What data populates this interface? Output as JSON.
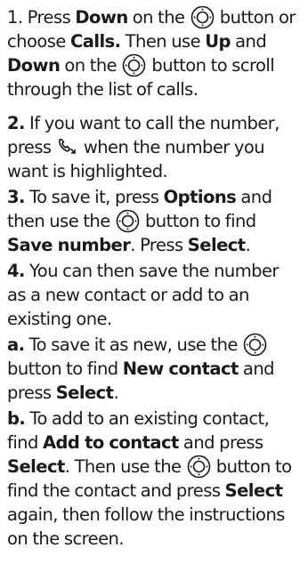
{
  "steps": [
    {
      "id": "1",
      "parts": [
        {
          "t": "1. Press "
        },
        {
          "b": "Down"
        },
        {
          "t": " on the "
        },
        {
          "icon": "nav-button"
        },
        {
          "t": " button or choose "
        },
        {
          "b": "Calls."
        },
        {
          "t": " Then use "
        },
        {
          "b": "Up"
        },
        {
          "t": " and "
        },
        {
          "b": "Down"
        },
        {
          "t": " on the "
        },
        {
          "icon": "nav-button"
        },
        {
          "t": " button to scroll through the list of calls."
        }
      ]
    },
    {
      "id": "2",
      "parts": [
        {
          "b": "2."
        },
        {
          "t": " If you want to call the number, press "
        },
        {
          "icon": "call-key"
        },
        {
          "t": " when the number you want is highlighted."
        }
      ]
    },
    {
      "id": "3",
      "parts": [
        {
          "b": "3."
        },
        {
          "t": " To save it, press "
        },
        {
          "b": "Options"
        },
        {
          "t": " and then use the "
        },
        {
          "icon": "nav-button"
        },
        {
          "t": " button to find "
        },
        {
          "b": "Save number"
        },
        {
          "t": ". Press "
        },
        {
          "b": "Select"
        },
        {
          "t": "."
        }
      ]
    },
    {
      "id": "4",
      "parts": [
        {
          "b": "4."
        },
        {
          "t": " You can then save the number as a new contact or add to an existing one."
        }
      ]
    },
    {
      "id": "a",
      "parts": [
        {
          "b": "a."
        },
        {
          "t": " To save it as new, use the "
        },
        {
          "icon": "nav-button"
        },
        {
          "t": " button to find "
        },
        {
          "b": "New contact"
        },
        {
          "t": " and press "
        },
        {
          "b": "Select"
        },
        {
          "t": "."
        }
      ]
    },
    {
      "id": "b",
      "parts": [
        {
          "b": "b."
        },
        {
          "t": " To add to an existing contact, find "
        },
        {
          "b": "Add to contact"
        },
        {
          "t": " and press "
        },
        {
          "b": "Select"
        },
        {
          "t": ". Then use the "
        },
        {
          "icon": "nav-button"
        },
        {
          "t": " button to find the contact and press "
        },
        {
          "b": "Select"
        },
        {
          "t": " again, then follow the instructions on the screen."
        }
      ]
    }
  ]
}
